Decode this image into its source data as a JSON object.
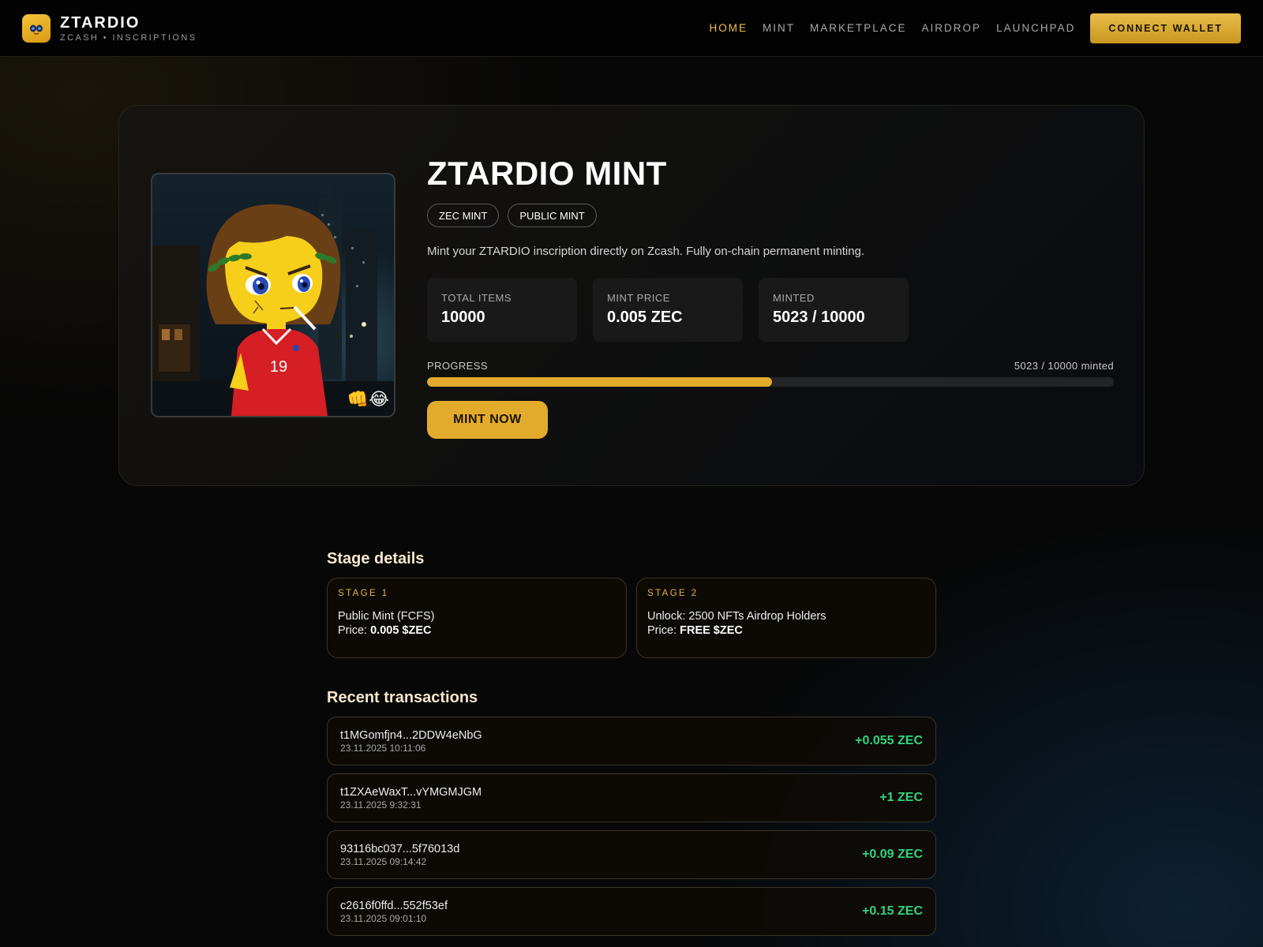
{
  "brand": {
    "name": "ZTARDIO",
    "subtitle": "ZCASH • INSCRIPTIONS",
    "icon": "mascot-face-icon",
    "accent": "#e3ab2c"
  },
  "nav": {
    "links": [
      "HOME",
      "MINT",
      "MARKETPLACE",
      "AIRDROP",
      "LAUNCHPAD"
    ],
    "active": "HOME",
    "connect_label": "CONNECT WALLET"
  },
  "hero": {
    "title": "ZTARDIO MINT",
    "badges": [
      "ZEC MINT",
      "PUBLIC MINT"
    ],
    "description": "Mint your ZTARDIO inscription directly on Zcash. Fully on-chain permanent minting.",
    "stats": [
      {
        "label": "TOTAL ITEMS",
        "value": "10000"
      },
      {
        "label": "MINT PRICE",
        "value": "0.005 ZEC"
      },
      {
        "label": "MINTED",
        "value": "5023 / 10000"
      }
    ],
    "progress": {
      "label": "PROGRESS",
      "text": "5023 / 10000 minted",
      "minted": 5023,
      "total": 10000
    },
    "mint_label": "MINT NOW",
    "art_overlay": "👊😂"
  },
  "stages": {
    "title": "Stage details",
    "items": [
      {
        "tag": "STAGE 1",
        "name": "Public Mint (FCFS)",
        "price_label": "Price:",
        "price": "0.005 $ZEC"
      },
      {
        "tag": "STAGE 2",
        "name": "Unlock: 2500 NFTs Airdrop Holders",
        "price_label": "Price:",
        "price": "FREE $ZEC"
      }
    ]
  },
  "transactions": {
    "title": "Recent transactions",
    "items": [
      {
        "hash": "t1MGomfjn4...2DDW4eNbG",
        "time": "23.11.2025 10:11:06",
        "amount": "+0.055 ZEC"
      },
      {
        "hash": "t1ZXAeWaxT...vYMGMJGM",
        "time": "23.11.2025 9:32:31",
        "amount": "+1 ZEC"
      },
      {
        "hash": "93116bc037...5f76013d",
        "time": "23.11.2025 09:14:42",
        "amount": "+0.09 ZEC"
      },
      {
        "hash": "c2616f0ffd...552f53ef",
        "time": "23.11.2025 09:01:10",
        "amount": "+0.15 ZEC"
      }
    ]
  }
}
